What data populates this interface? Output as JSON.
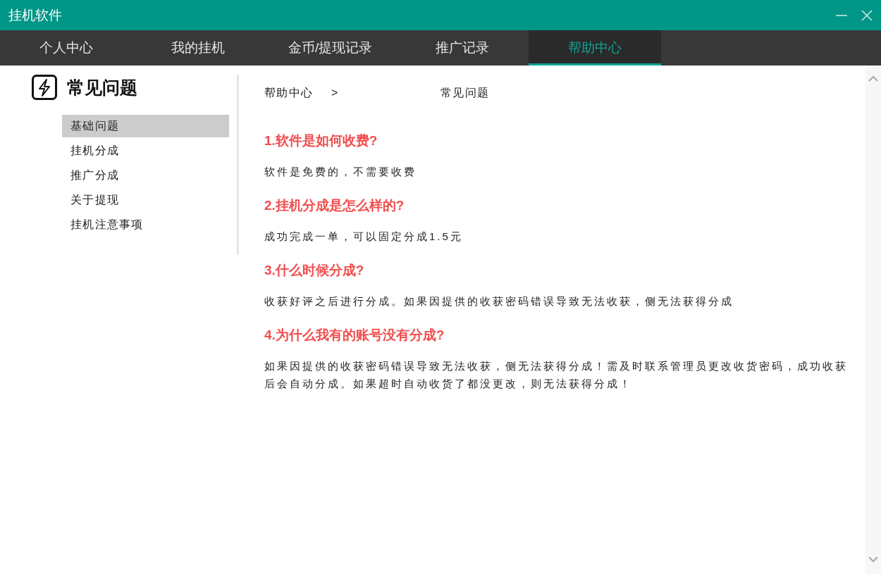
{
  "window": {
    "title": "挂机软件"
  },
  "tabs": [
    {
      "label": "个人中心",
      "selected": false
    },
    {
      "label": "我的挂机",
      "selected": false
    },
    {
      "label": "金币/提现记录",
      "selected": false
    },
    {
      "label": "推广记录",
      "selected": false
    },
    {
      "label": "帮助中心",
      "selected": true
    }
  ],
  "sidebar": {
    "title": "常见问题",
    "items": [
      {
        "label": "基础问题",
        "selected": true
      },
      {
        "label": "挂机分成",
        "selected": false
      },
      {
        "label": "推广分成",
        "selected": false
      },
      {
        "label": "关于提现",
        "selected": false
      },
      {
        "label": "挂机注意事项",
        "selected": false
      }
    ]
  },
  "breadcrumb": [
    "帮助中心",
    ">",
    "常见问题"
  ],
  "faq": [
    {
      "question": "1.软件是如何收费?",
      "answer": "软件是免费的，不需要收费"
    },
    {
      "question": "2.挂机分成是怎么样的?",
      "answer": "成功完成一单，可以固定分成1.5元"
    },
    {
      "question": "3.什么时候分成?",
      "answer": "收获好评之后进行分成。如果因提供的收获密码错误导致无法收获，侧无法获得分成"
    },
    {
      "question": "4.为什么我有的账号没有分成?",
      "answer": "如果因提供的收获密码错误导致无法收获，侧无法获得分成！需及时联系管理员更改收货密码，成功收获后会自动分成。如果超时自动收货了都没更改，则无法获得分成！"
    }
  ]
}
